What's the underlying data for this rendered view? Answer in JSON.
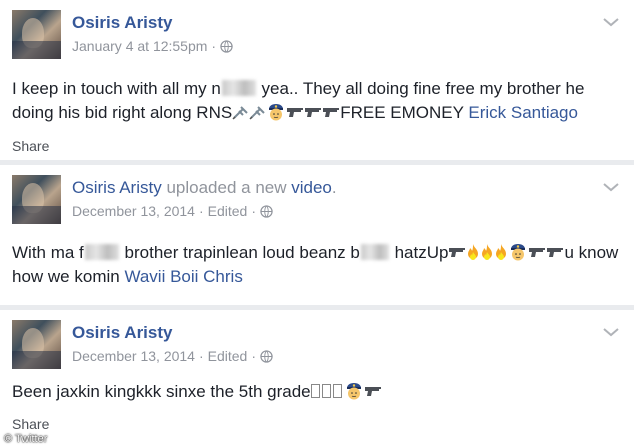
{
  "posts": [
    {
      "author": "Osiris Aristy",
      "action_text": "",
      "action_link": "",
      "date": "January 4 at 12:55pm",
      "edited": "",
      "text_1": "I keep in touch with all my n",
      "text_2": " yea.. They all doing fine free my brother he doing his bid right along RNS",
      "text_3": "FREE EMONEY",
      "tag": "Erick Santiago",
      "share": "Share"
    },
    {
      "author": "Osiris Aristy",
      "action_text": " uploaded a new ",
      "action_link": "video",
      "date": "December 13, 2014",
      "edited": "Edited",
      "text_1": "With ma f",
      "text_2": " brother trapinlean loud beanz b",
      "text_3": " hatzUp",
      "text_4": "u know how we komin ",
      "tag": "Wavii Boii Chris",
      "share": ""
    },
    {
      "author": "Osiris Aristy",
      "action_text": "",
      "action_link": "",
      "date": "December 13, 2014",
      "edited": "Edited",
      "text_1": "Been jaxkin kingkkk sinxe the 5th grade",
      "share": "Share"
    }
  ],
  "watermark": "© Twitter",
  "colors": {
    "link": "#365899",
    "meta": "#90949c",
    "text": "#1d2129",
    "background": "#e9ebee"
  }
}
